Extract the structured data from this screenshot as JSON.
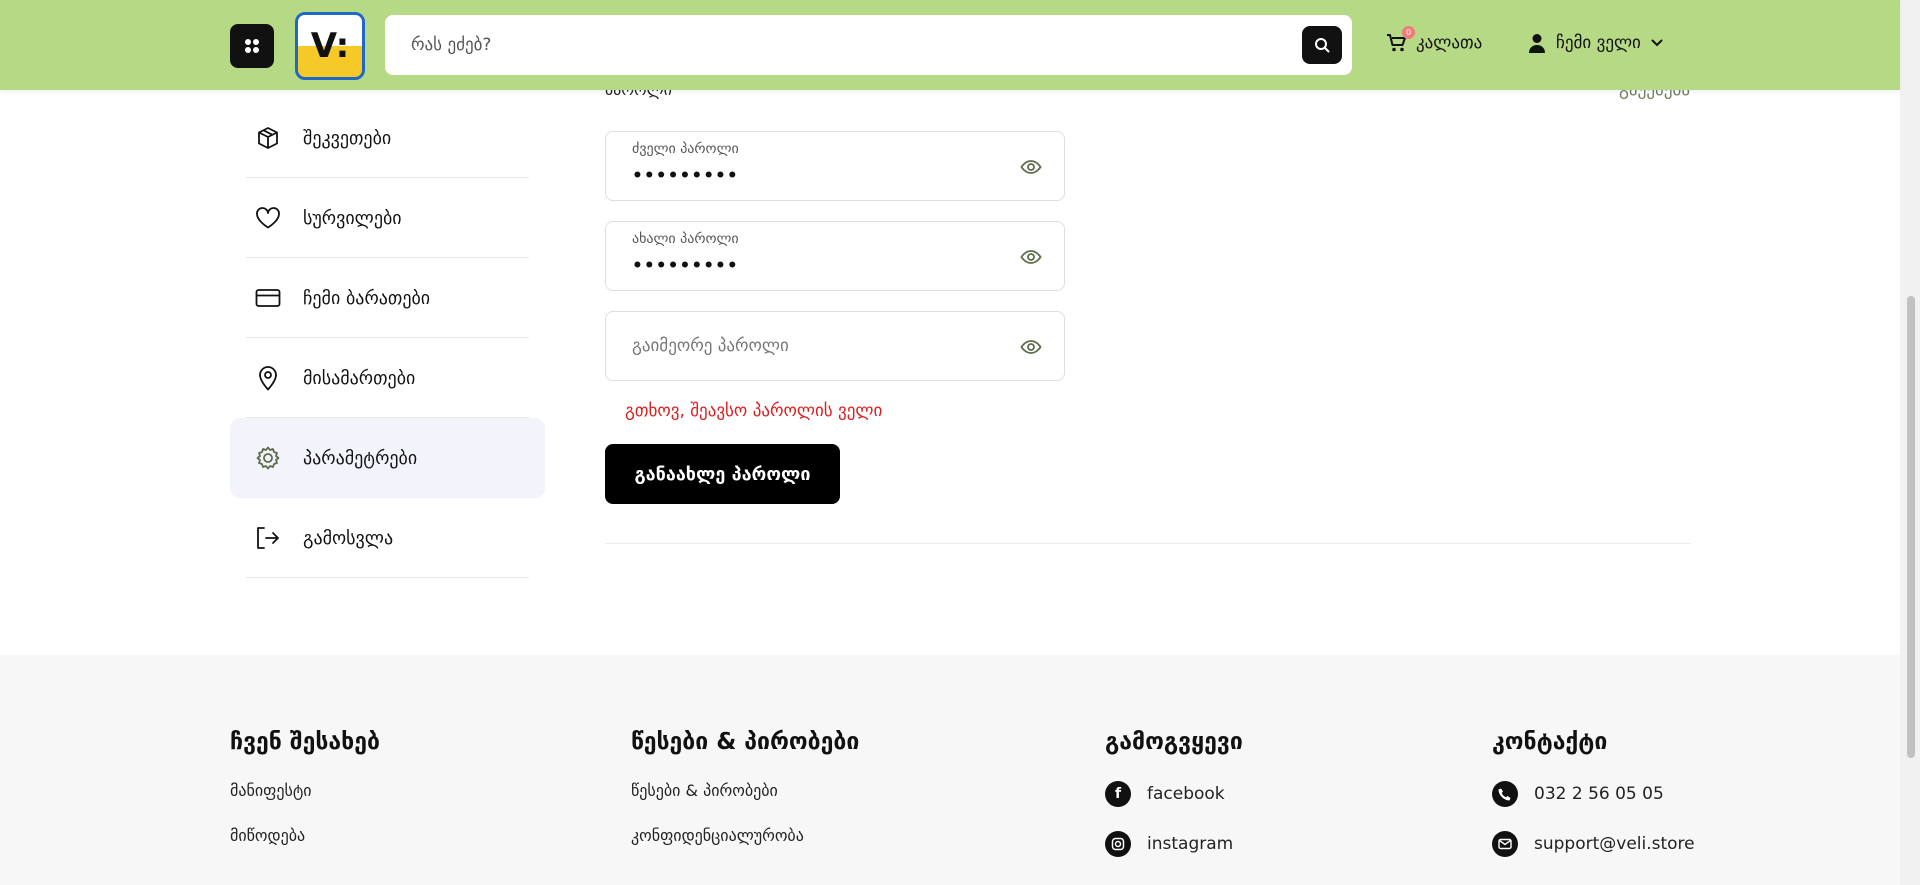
{
  "header": {
    "logo_text": "V:",
    "search": {
      "placeholder": "რას ეძებ?"
    },
    "cart": {
      "label": "კალათა",
      "count": "0"
    },
    "account": {
      "label": "ჩემი ველი"
    }
  },
  "sidebar": {
    "items": [
      {
        "label": "შეკვეთები",
        "icon": "box-icon"
      },
      {
        "label": "სურვილები",
        "icon": "heart-icon"
      },
      {
        "label": "ჩემი ბარათები",
        "icon": "credit-card-icon"
      },
      {
        "label": "მისამართები",
        "icon": "location-pin-icon"
      },
      {
        "label": "პარამეტრები",
        "icon": "gear-icon",
        "active": true
      },
      {
        "label": "გამოსვლა",
        "icon": "logout-icon"
      }
    ]
  },
  "main": {
    "section_label": "პაროლი",
    "section_link": "გაუქმება",
    "old_password": {
      "label": "ძველი პაროლი",
      "value": "•••••••••"
    },
    "new_password": {
      "label": "ახალი პაროლი",
      "value": "•••••••••"
    },
    "repeat_password": {
      "placeholder": "გაიმეორე პაროლი"
    },
    "error": "გთხოვ, შეავსო პაროლის ველი",
    "submit_label": "განაახლე პაროლი"
  },
  "footer": {
    "about": {
      "title": "ჩვენ შესახებ",
      "links": [
        "მანიფესტი",
        "მიწოდება"
      ]
    },
    "terms": {
      "title": "წესები & პირობები",
      "links": [
        "წესები & პირობები",
        "კონფიდენციალურობა"
      ]
    },
    "follow": {
      "title": "გამოგვყევი",
      "links": [
        {
          "label": "facebook",
          "icon": "facebook-icon"
        },
        {
          "label": "instagram",
          "icon": "instagram-icon"
        }
      ]
    },
    "contact": {
      "title": "კონტაქტი",
      "phone": "032 2 56 05 05",
      "email": "support@veli.store"
    }
  },
  "colors": {
    "header_bg": "#b6d985",
    "error": "#e01b1b",
    "button_bg": "#000000",
    "active_bg": "#f3f3fb",
    "footer_bg": "#f6f7f6"
  }
}
